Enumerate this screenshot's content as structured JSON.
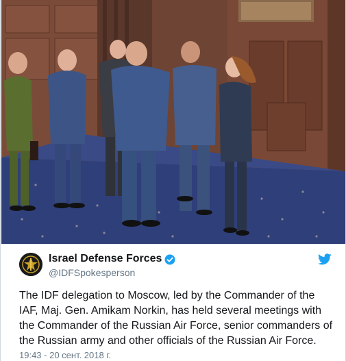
{
  "tweet": {
    "display_name": "Israel Defense Forces",
    "handle": "@IDFSpokesperson",
    "text_lines": [
      "The IDF delegation to Moscow, led by the Commander of the",
      "IAF, Maj. Gen. Amikam Norkin, has held several meetings with",
      "the Commander of the Russian Air Force, senior commanders of",
      "the Russian army and other officials of the Russian Air Force."
    ],
    "timestamp": "19:43 - 20 сент. 2018 г.",
    "verified": true
  },
  "icons": {
    "verified": "verified-badge-icon",
    "platform": "twitter-bird-icon",
    "avatar": "idf-emblem-avatar"
  },
  "colors": {
    "twitter_blue": "#1da1f2",
    "name_text": "#14171a",
    "secondary_text": "#657786",
    "border": "#cfd9de"
  }
}
